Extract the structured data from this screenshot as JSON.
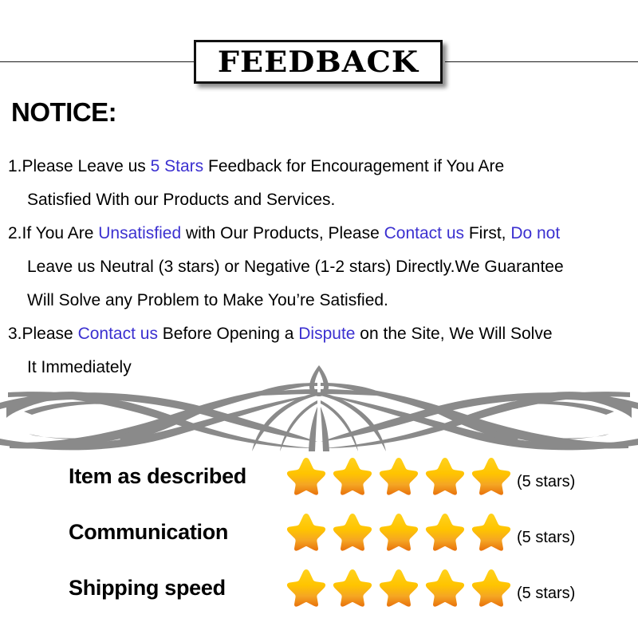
{
  "banner": {
    "title": "FEEDBACK"
  },
  "notice": {
    "heading": "NOTICE:",
    "lines": [
      {
        "id": "item-1-line-1",
        "segments": [
          {
            "text": "1.Please Leave us  ",
            "style": "plain"
          },
          {
            "text": "5 Stars",
            "style": "highlight"
          },
          {
            "text": "  Feedback for  Encouragement  if You Are",
            "style": "plain"
          }
        ]
      },
      {
        "id": "item-1-line-2",
        "indent": true,
        "segments": [
          {
            "text": "Satisfied With our Products and Services.",
            "style": "plain"
          }
        ]
      },
      {
        "id": "item-2-line-1",
        "segments": [
          {
            "text": "2.If You Are ",
            "style": "plain"
          },
          {
            "text": "Unsatisfied",
            "style": "highlight"
          },
          {
            "text": " with Our Products, Please ",
            "style": "plain"
          },
          {
            "text": "Contact us",
            "style": "highlight"
          },
          {
            "text": " First, ",
            "style": "plain"
          },
          {
            "text": "Do not",
            "style": "highlight"
          }
        ]
      },
      {
        "id": "item-2-line-2",
        "indent": true,
        "segments": [
          {
            "text": "Leave us Neutral (3 stars) or Negative (1-2 stars) Directly.We Guarantee",
            "style": "plain"
          }
        ]
      },
      {
        "id": "item-2-line-3",
        "indent": true,
        "segments": [
          {
            "text": "Will Solve any Problem to Make You’re  Satisfied.",
            "style": "plain"
          }
        ]
      },
      {
        "id": "item-3-line-1",
        "segments": [
          {
            "text": "3.Please ",
            "style": "plain"
          },
          {
            "text": "Contact us",
            "style": "highlight"
          },
          {
            "text": " Before Opening a ",
            "style": "plain"
          },
          {
            "text": "Dispute",
            "style": "highlight"
          },
          {
            "text": " on the Site, We Will Solve",
            "style": "plain"
          }
        ]
      },
      {
        "id": "item-3-line-2",
        "indent": true,
        "segments": [
          {
            "text": "It Immediately",
            "style": "plain"
          }
        ]
      }
    ]
  },
  "divider": {
    "icon": "tribal-flourish-ornament",
    "color": "#8a8a8a"
  },
  "ratings": [
    {
      "label": "Item as described",
      "stars": 5,
      "count_text": "(5 stars)"
    },
    {
      "label": "Communication",
      "stars": 5,
      "count_text": "(5 stars)"
    },
    {
      "label": "Shipping speed",
      "stars": 5,
      "count_text": "(5 stars)"
    }
  ],
  "colors": {
    "highlight_blue": "#3b30d0",
    "star_top": "#ffd21e",
    "star_mid": "#f5a623",
    "star_bottom": "#e8720c",
    "ornament_gray": "#8a8a8a",
    "text_black": "#000000",
    "background": "#ffffff"
  }
}
